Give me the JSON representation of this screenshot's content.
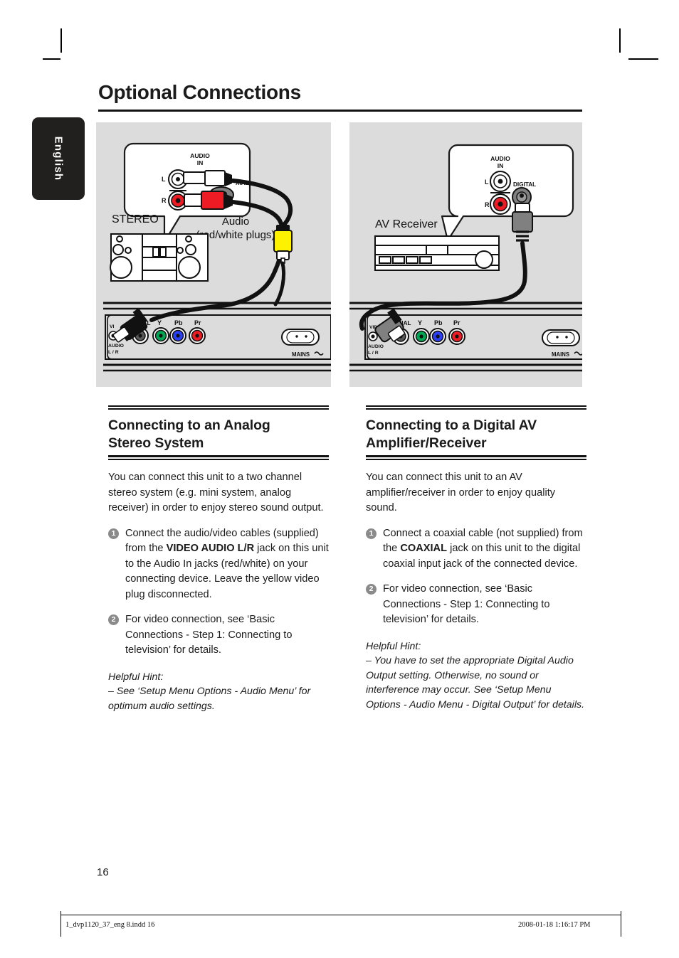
{
  "page": {
    "title": "Optional Connections",
    "language_tab": "English",
    "page_number": "16"
  },
  "footer": {
    "file": "1_dvp1120_37_eng 8.indd   16",
    "timestamp": "2008-01-18   1:16:17 PM"
  },
  "diagrams": {
    "left": {
      "device_label": "STEREO",
      "cable_label_line1": "Audio",
      "cable_label_line2": "(red/white plugs)",
      "callout": {
        "title_line1": "AUDIO",
        "title_line2": "IN",
        "jack_l": "L",
        "jack_r": "R",
        "coaxial_label": "XIAL"
      },
      "rear_panel": {
        "video_label": "VI",
        "coaxial_label": "AXIAL",
        "audio_label_line1": "AUDIO",
        "audio_label_line2": "L / R",
        "component": [
          "Y",
          "Pb",
          "Pr"
        ],
        "mains_label": "MAINS"
      }
    },
    "right": {
      "device_label": "AV Receiver",
      "callout": {
        "title_line1": "AUDIO",
        "title_line2": "IN",
        "jack_l": "L",
        "jack_r": "R",
        "digital_label": "DIGITAL"
      },
      "rear_panel": {
        "video_label": "VIDEO",
        "coaxial_label": "AXIAL",
        "audio_label_line1": "AUDIO",
        "audio_label_line2": "L / R",
        "component": [
          "Y",
          "Pb",
          "Pr"
        ],
        "mains_label": "MAINS"
      }
    }
  },
  "sections": {
    "left": {
      "heading_line1": "Connecting to an Analog",
      "heading_line2": "Stereo System",
      "intro": "You can connect this unit to a two channel stereo system (e.g. mini system, analog receiver) in order to enjoy stereo sound output.",
      "steps": [
        {
          "num": "1",
          "pre": "Connect the audio/video cables (supplied) from the ",
          "bold": "VIDEO AUDIO L/R",
          "post": " jack on this unit to the Audio In jacks (red/white) on your connecting device. Leave the yellow video plug disconnected."
        },
        {
          "num": "2",
          "pre": "For video connection, see ‘Basic Connections - Step 1: Connecting to television’ for details.",
          "bold": "",
          "post": ""
        }
      ],
      "hint_label": "Helpful Hint:",
      "hint_text": "–  See ‘Setup Menu Options - Audio Menu’ for optimum audio settings."
    },
    "right": {
      "heading_line1": "Connecting to a Digital AV",
      "heading_line2": "Amplifier/Receiver",
      "intro": "You can connect this unit to an AV amplifier/receiver in order to enjoy quality sound.",
      "steps": [
        {
          "num": "1",
          "pre": "Connect a coaxial cable (not supplied) from the ",
          "bold": "COAXIAL",
          "post": " jack on this unit to the digital coaxial input jack of the connected device."
        },
        {
          "num": "2",
          "pre": "For video connection, see ‘Basic Connections - Step 1: Connecting to television’ for details.",
          "bold": "",
          "post": ""
        }
      ],
      "hint_label": "Helpful Hint:",
      "hint_text": "–  You have to set the appropriate Digital Audio Output setting. Otherwise, no sound or interference may occur. See ‘Setup Menu Options - Audio Menu - Digital Output’ for details."
    }
  },
  "colors": {
    "panel_bg": "#dcdcdc",
    "red": "#ed1c24",
    "green": "#00a651",
    "blue": "#2b3ff2",
    "yellow": "#fff200",
    "gray_connector": "#808080",
    "step_badge": "#8a8a8a",
    "tab_bg": "#221f1f"
  }
}
